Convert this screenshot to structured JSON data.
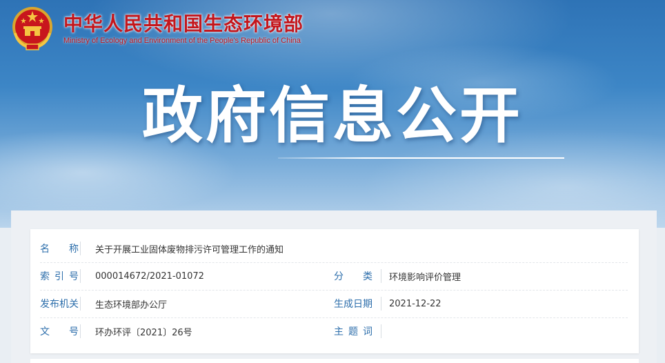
{
  "header": {
    "org_name_cn": "中华人民共和国生态环境部",
    "org_name_en": "Ministry of Ecology and Environment of the People's Republic of China",
    "emblem_icon": "national-emblem-icon",
    "banner_title": "政府信息公开"
  },
  "colors": {
    "brand_red": "#c4161c",
    "label_blue": "#2c6eab",
    "sky_blue": "#3d86c6"
  },
  "info": {
    "name_label": "名 称",
    "name_value": "关于开展工业固体废物排污许可管理工作的通知",
    "index_label": "索 引 号",
    "index_value": "000014672/2021-01072",
    "category_label": "分 类",
    "category_value": "环境影响评价管理",
    "publisher_label": "发布机关",
    "publisher_value": "生态环境部办公厅",
    "date_label": "生成日期",
    "date_value": "2021-12-22",
    "doc_no_label": "文 号",
    "doc_no_value": "环办环评〔2021〕26号",
    "subject_label": "主 题 词",
    "subject_value": ""
  }
}
